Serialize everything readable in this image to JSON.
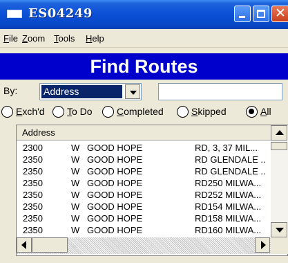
{
  "window": {
    "title": "ES04249",
    "titlebar_color": "#0a4fd6",
    "close_color": "#c8401c"
  },
  "menu": {
    "items": [
      "File",
      "Zoom",
      "Tools",
      "Help"
    ]
  },
  "banner": {
    "title": "Find Routes",
    "background": "#0000cc"
  },
  "search": {
    "by_label": "By:",
    "by_value": "Address",
    "input_value": "",
    "input_placeholder": ""
  },
  "filters": {
    "options": [
      "Exch'd",
      "To Do",
      "Completed",
      "Skipped",
      "All"
    ],
    "selected": "All"
  },
  "list": {
    "header": "Address",
    "rows": [
      {
        "num": "2300",
        "dir": "W",
        "street": "GOOD HOPE",
        "rest": "RD, 3, 37 MIL..."
      },
      {
        "num": "2350",
        "dir": "W",
        "street": "GOOD HOPE",
        "rest": "RD GLENDALE .."
      },
      {
        "num": "2350",
        "dir": "W",
        "street": "GOOD HOPE",
        "rest": "RD GLENDALE .."
      },
      {
        "num": "2350",
        "dir": "W",
        "street": "GOOD HOPE",
        "rest": "RD250 MILWA..."
      },
      {
        "num": "2350",
        "dir": "W",
        "street": "GOOD HOPE",
        "rest": "RD252 MILWA..."
      },
      {
        "num": "2350",
        "dir": "W",
        "street": "GOOD HOPE",
        "rest": "RD154 MILWA..."
      },
      {
        "num": "2350",
        "dir": "W",
        "street": "GOOD HOPE",
        "rest": "RD158 MILWA..."
      },
      {
        "num": "2350",
        "dir": "W",
        "street": "GOOD HOPE",
        "rest": "RD160 MILWA..."
      }
    ]
  },
  "icons": {
    "app": "window-icon",
    "minimize": "minimize-icon",
    "maximize": "maximize-icon",
    "close": "close-icon",
    "dropdown": "chevron-down-icon",
    "scroll_up": "arrow-up-icon",
    "scroll_down": "arrow-down-icon",
    "scroll_left": "arrow-left-icon",
    "scroll_right": "arrow-right-icon"
  }
}
